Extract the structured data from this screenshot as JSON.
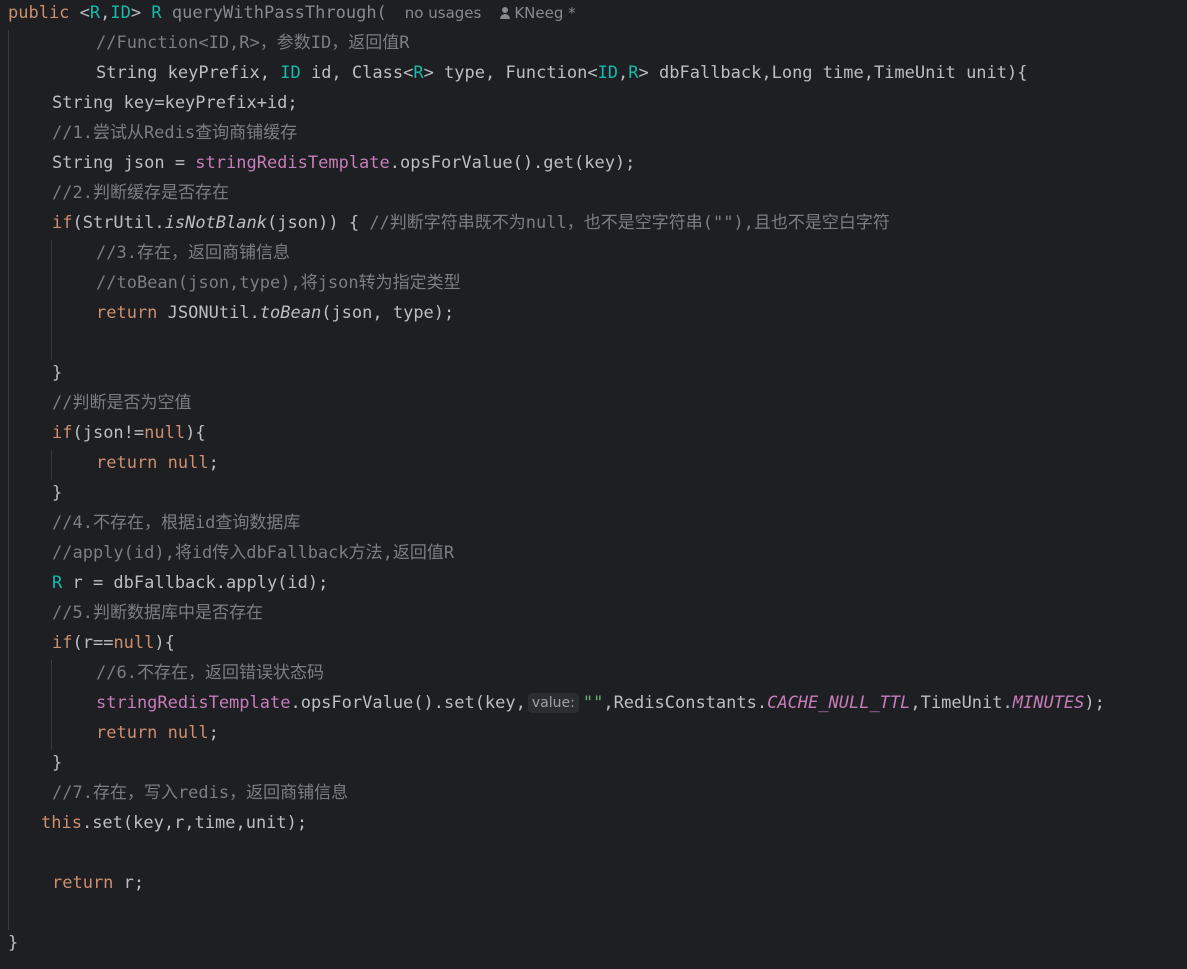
{
  "signature": {
    "kw_public": "public",
    "lt": " <",
    "type_r": "R",
    "comma": ",",
    "type_id": "ID",
    "gt": "> ",
    "ret_type": "R",
    "method": " queryWithPassThrough(",
    "usages": "no usages",
    "author": "KNeeg *"
  },
  "l2": {
    "comment": "//Function<ID,R>，参数ID，返回值R"
  },
  "l3": {
    "a": "String keyPrefix, ",
    "id1": "ID",
    "b": " id, Class<",
    "r1": "R",
    "c": "> type, Function<",
    "id2": "ID",
    "d": ",",
    "r2": "R",
    "e": "> dbFallback,Long time,TimeUnit unit){"
  },
  "l4": {
    "code": "String key=keyPrefix+id;"
  },
  "l5": {
    "comment": "//1.尝试从Redis查询商铺缓存"
  },
  "l6": {
    "a": "String json = ",
    "field": "stringRedisTemplate",
    "b": ".opsForValue().get(key);"
  },
  "l7": {
    "comment": "//2.判断缓存是否存在"
  },
  "l8": {
    "kw": "if",
    "a": "(StrUtil.",
    "m": "isNotBlank",
    "b": "(json)) { ",
    "comment": "//判断字符串既不为null，也不是空字符串(\"\"),且也不是空白字符"
  },
  "l9": {
    "comment": "//3.存在，返回商铺信息"
  },
  "l10": {
    "comment": "//toBean(json,type),将json转为指定类型"
  },
  "l11": {
    "kw": "return",
    "a": " JSONUtil.",
    "m": "toBean",
    "b": "(json, type);"
  },
  "l13": {
    "code": "}"
  },
  "l14": {
    "comment": "//判断是否为空值"
  },
  "l15": {
    "kw": "if",
    "a": "(json!=",
    "kw2": "null",
    "b": "){"
  },
  "l16": {
    "kw": "return",
    "sp": " ",
    "kw2": "null",
    "b": ";"
  },
  "l17": {
    "code": "}"
  },
  "l18": {
    "comment": "//4.不存在，根据id查询数据库"
  },
  "l19": {
    "comment": "//apply(id),将id传入dbFallback方法,返回值R"
  },
  "l20": {
    "t": "R",
    "a": " r = dbFallback.apply(id);"
  },
  "l21": {
    "comment": "//5.判断数据库中是否存在"
  },
  "l22": {
    "kw": "if",
    "a": "(r==",
    "kw2": "null",
    "b": "){"
  },
  "l23": {
    "comment": "//6.不存在，返回错误状态码"
  },
  "l24": {
    "field": "stringRedisTemplate",
    "a": ".opsForValue().set(key,",
    "hint": "value:",
    "str": "\"\"",
    "b": ",RedisConstants.",
    "c1": "CACHE_NULL_TTL",
    "c": ",TimeUnit.",
    "c2": "MINUTES",
    "d": ");"
  },
  "l25": {
    "kw": "return",
    "sp": " ",
    "kw2": "null",
    "b": ";"
  },
  "l26": {
    "code": "}"
  },
  "l27": {
    "comment": "//7.存在，写入redis，返回商铺信息"
  },
  "l28": {
    "kw": "this",
    "a": ".set(key,r,time,unit);"
  },
  "l30": {
    "kw": "return",
    "a": " r;"
  },
  "l32": {
    "code": "}"
  }
}
